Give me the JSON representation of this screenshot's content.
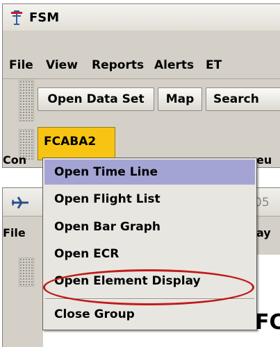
{
  "fsm_window": {
    "title": "FSM",
    "menus": [
      "File",
      "View",
      "Reports",
      "Alerts",
      "ET"
    ],
    "toolbar": {
      "open_data_set": "Open Data Set",
      "map": "Map",
      "search": "Search"
    },
    "group_tab": "FCABA2",
    "partial_text_left": "Con",
    "partial_text_right": "eu"
  },
  "second_window": {
    "title_partial": "05",
    "menu_file_partial": "File",
    "menu_right_partial": "ay",
    "content_partial": "FC"
  },
  "context_menu": {
    "items": [
      {
        "label": "Open Time Line",
        "selected": true
      },
      {
        "label": "Open Flight List",
        "selected": false
      },
      {
        "label": "Open Bar Graph",
        "selected": false
      },
      {
        "label": "Open ECR",
        "selected": false
      },
      {
        "label": "Open Element Display",
        "selected": false
      }
    ],
    "close_group": "Close Group"
  },
  "colors": {
    "window_bg": "#d4d0c8",
    "selection": "#a4a4d4",
    "group_tab": "#f7c413",
    "highlight_ellipse": "#c01b1b"
  }
}
